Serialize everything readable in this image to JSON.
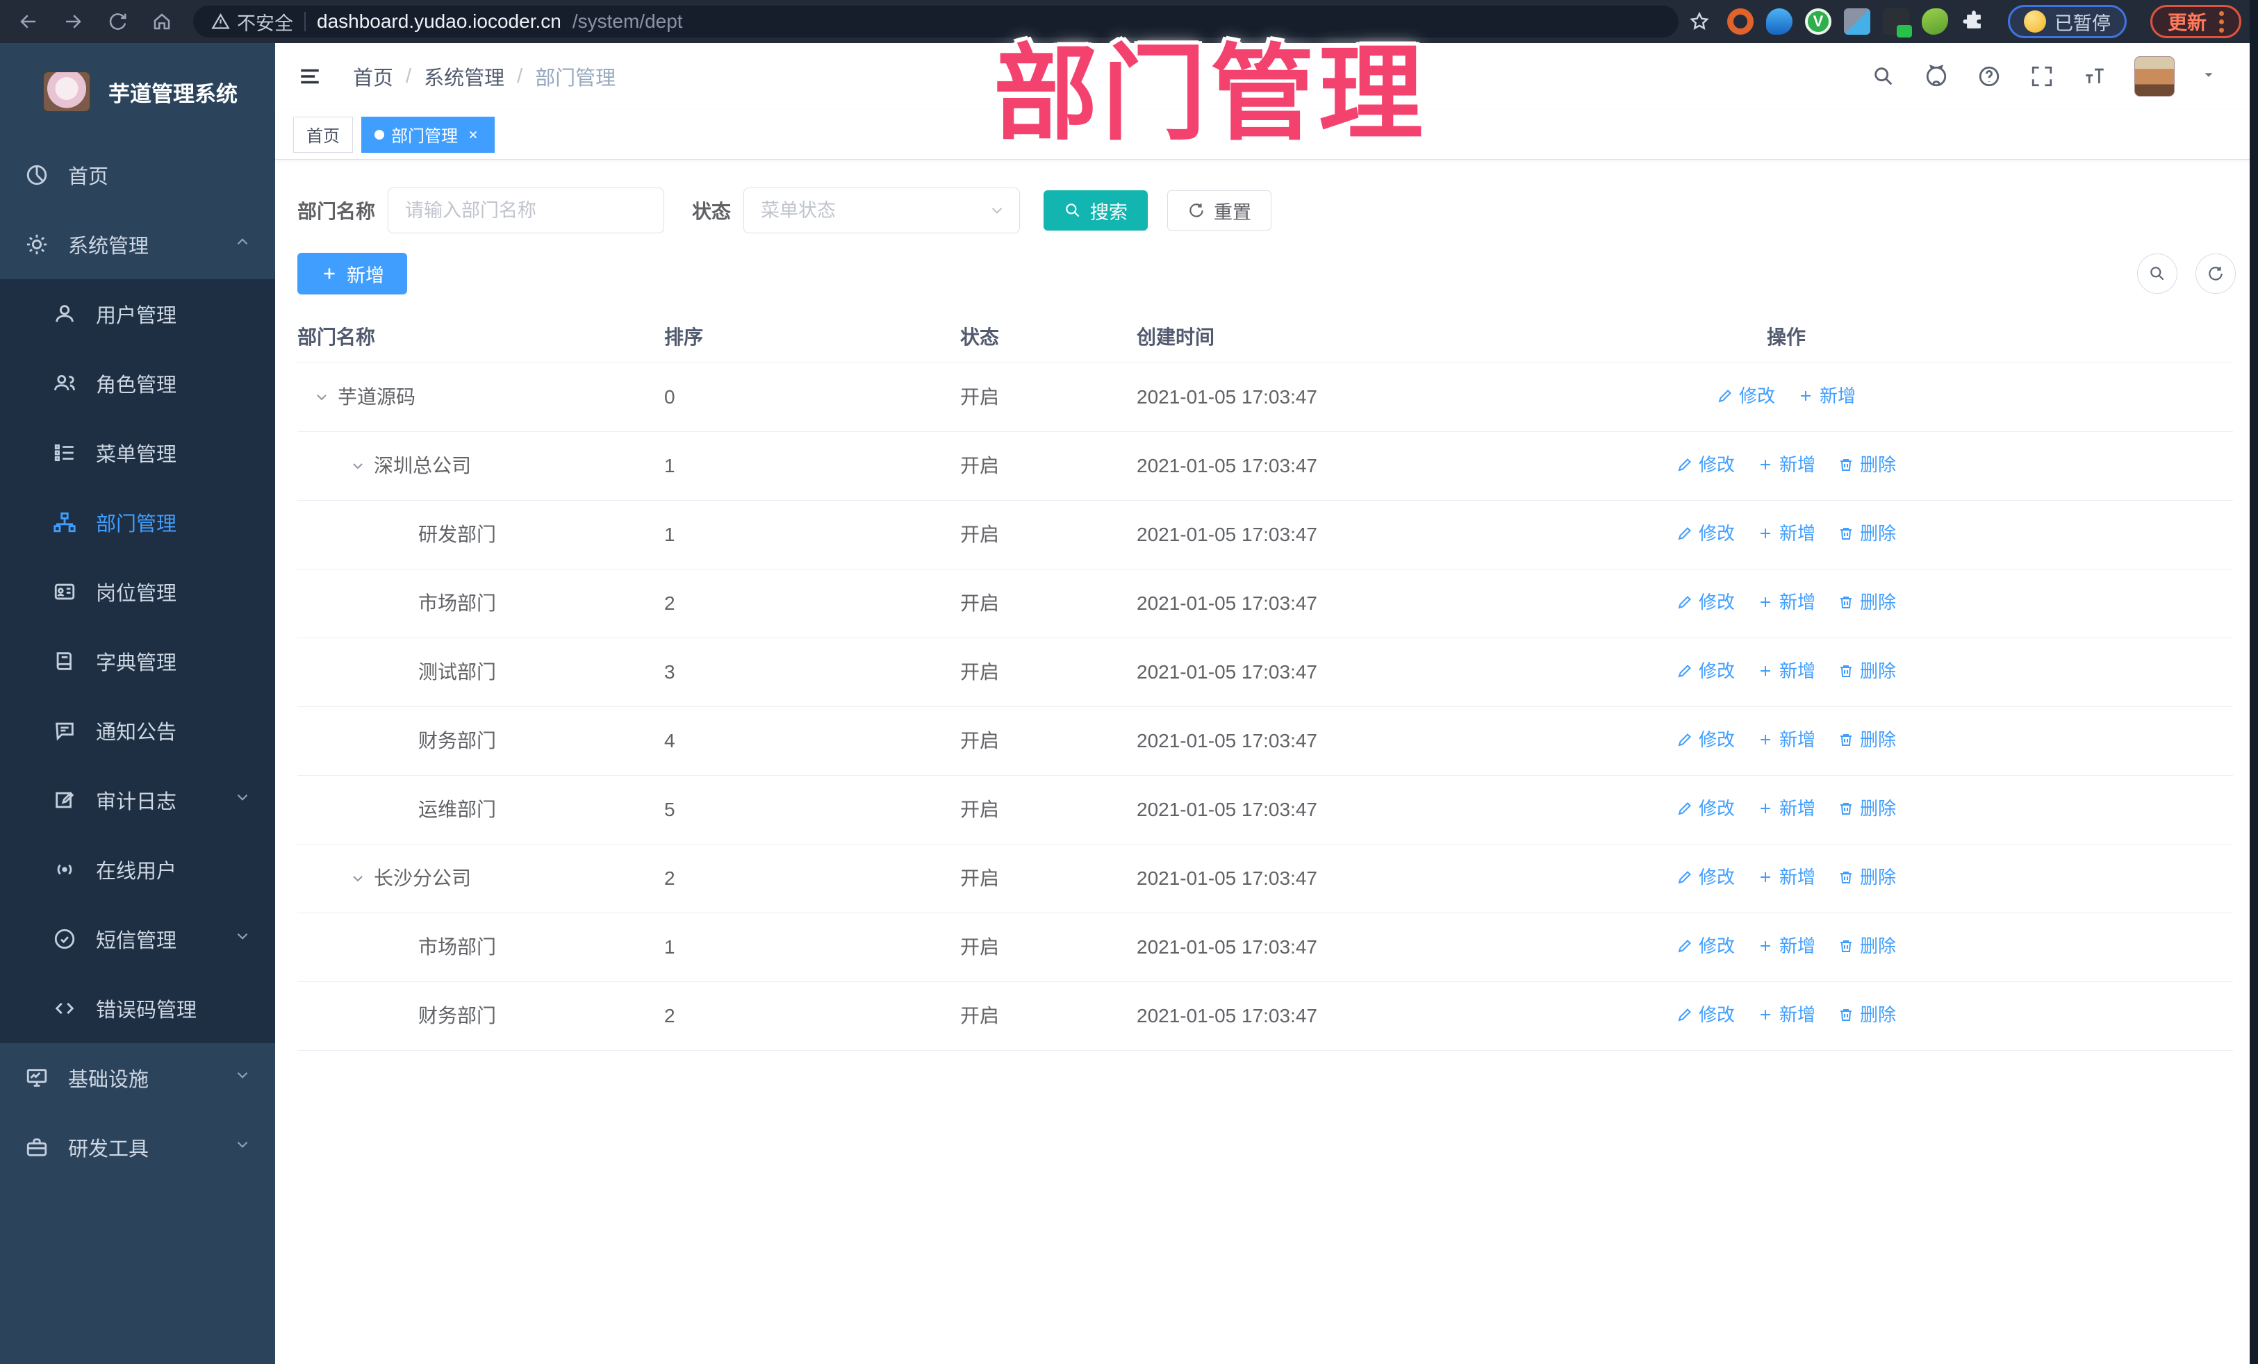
{
  "colors": {
    "accent_blue": "#409EFF",
    "search_teal": "#13b5b1",
    "overlay_pink": "#f4426e",
    "sidebar_bg": "#2b445c",
    "submenu_bg": "#1e2f44",
    "browser_bar_bg": "#232b39"
  },
  "browser": {
    "security_label": "不安全",
    "url_host": "dashboard.yudao.iocoder.cn",
    "url_path": "/system/dept",
    "paused_badge_label": "已暂停",
    "update_button_label": "更新"
  },
  "overlay_title": "部门管理",
  "sidebar": {
    "logo_title": "芋道管理系统",
    "items": [
      {
        "label": "首页",
        "icon": "dashboard-icon",
        "level": "root"
      },
      {
        "label": "系统管理",
        "icon": "gear-icon",
        "level": "root",
        "expanded": true
      },
      {
        "label": "用户管理",
        "icon": "user-icon",
        "level": "sub"
      },
      {
        "label": "角色管理",
        "icon": "users-icon",
        "level": "sub"
      },
      {
        "label": "菜单管理",
        "icon": "menu-list-icon",
        "level": "sub"
      },
      {
        "label": "部门管理",
        "icon": "org-tree-icon",
        "level": "sub",
        "active": true
      },
      {
        "label": "岗位管理",
        "icon": "id-card-icon",
        "level": "sub"
      },
      {
        "label": "字典管理",
        "icon": "dictionary-icon",
        "level": "sub"
      },
      {
        "label": "通知公告",
        "icon": "announcement-icon",
        "level": "sub"
      },
      {
        "label": "审计日志",
        "icon": "audit-log-icon",
        "level": "sub",
        "collapsible": true
      },
      {
        "label": "在线用户",
        "icon": "online-users-icon",
        "level": "sub"
      },
      {
        "label": "短信管理",
        "icon": "sms-icon",
        "level": "sub",
        "collapsible": true
      },
      {
        "label": "错误码管理",
        "icon": "error-code-icon",
        "level": "sub"
      },
      {
        "label": "基础设施",
        "icon": "infrastructure-icon",
        "level": "root",
        "collapsible": true
      },
      {
        "label": "研发工具",
        "icon": "dev-tools-icon",
        "level": "root",
        "collapsible": true
      }
    ]
  },
  "header": {
    "breadcrumb": [
      "首页",
      "系统管理",
      "部门管理"
    ],
    "breadcrumb_separator": "/"
  },
  "tags": [
    {
      "label": "首页",
      "active": false
    },
    {
      "label": "部门管理",
      "active": true,
      "closable": true
    }
  ],
  "filters": {
    "dept_name_label": "部门名称",
    "dept_name_placeholder": "请输入部门名称",
    "status_label": "状态",
    "status_placeholder": "菜单状态",
    "search_label": "搜索",
    "reset_label": "重置"
  },
  "toolbar": {
    "add_label": "新增"
  },
  "row_actions": {
    "edit": "修改",
    "add": "新增",
    "delete": "删除"
  },
  "table": {
    "columns": [
      "部门名称",
      "排序",
      "状态",
      "创建时间",
      "操作"
    ],
    "rows": [
      {
        "name": "芋道源码",
        "level": 0,
        "expandable": true,
        "sort": "0",
        "status": "开启",
        "created": "2021-01-05 17:03:47",
        "deletable": false
      },
      {
        "name": "深圳总公司",
        "level": 1,
        "expandable": true,
        "sort": "1",
        "status": "开启",
        "created": "2021-01-05 17:03:47",
        "deletable": true
      },
      {
        "name": "研发部门",
        "level": 2,
        "expandable": false,
        "sort": "1",
        "status": "开启",
        "created": "2021-01-05 17:03:47",
        "deletable": true
      },
      {
        "name": "市场部门",
        "level": 2,
        "expandable": false,
        "sort": "2",
        "status": "开启",
        "created": "2021-01-05 17:03:47",
        "deletable": true
      },
      {
        "name": "测试部门",
        "level": 2,
        "expandable": false,
        "sort": "3",
        "status": "开启",
        "created": "2021-01-05 17:03:47",
        "deletable": true
      },
      {
        "name": "财务部门",
        "level": 2,
        "expandable": false,
        "sort": "4",
        "status": "开启",
        "created": "2021-01-05 17:03:47",
        "deletable": true
      },
      {
        "name": "运维部门",
        "level": 2,
        "expandable": false,
        "sort": "5",
        "status": "开启",
        "created": "2021-01-05 17:03:47",
        "deletable": true
      },
      {
        "name": "长沙分公司",
        "level": 1,
        "expandable": true,
        "sort": "2",
        "status": "开启",
        "created": "2021-01-05 17:03:47",
        "deletable": true
      },
      {
        "name": "市场部门",
        "level": 2,
        "expandable": false,
        "sort": "1",
        "status": "开启",
        "created": "2021-01-05 17:03:47",
        "deletable": true
      },
      {
        "name": "财务部门",
        "level": 2,
        "expandable": false,
        "sort": "2",
        "status": "开启",
        "created": "2021-01-05 17:03:47",
        "deletable": true
      }
    ]
  }
}
